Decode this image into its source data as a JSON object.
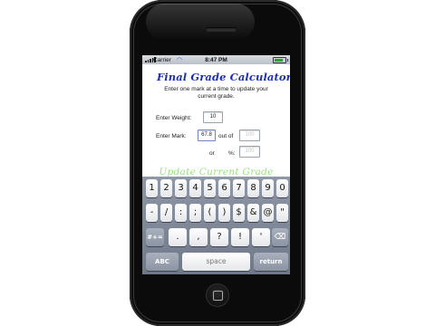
{
  "status_bar": {
    "carrier": "Carrier",
    "time": "8:47 PM"
  },
  "app": {
    "title": "Final Grade Calculator",
    "instruction_line1": "Enter one mark at a time to update your",
    "instruction_line2": "current grade.",
    "weight_label": "Enter Weight:",
    "weight_value": "10",
    "mark_label": "Enter Mark:",
    "mark_value": "67.8",
    "out_of_label": "out of",
    "out_of_placeholder": "100",
    "or_label": "or",
    "percent_label": "%:",
    "percent_placeholder": "100",
    "update_button": "Update Current Grade"
  },
  "keyboard": {
    "row1": [
      "1",
      "2",
      "3",
      "4",
      "5",
      "6",
      "7",
      "8",
      "9",
      "0"
    ],
    "row2": [
      "-",
      "/",
      ":",
      ";",
      "(",
      ")",
      "$",
      "&",
      "@",
      "\""
    ],
    "row3_left": "#+=",
    "row3": [
      ".",
      ",",
      "?",
      "!",
      "'"
    ],
    "row3_right": "backspace",
    "abc": "ABC",
    "space": "space",
    "return": "return"
  },
  "colors": {
    "title": "#1c2fb8",
    "update_button": "#9be07e",
    "keyboard_bg": "#7f8898"
  }
}
